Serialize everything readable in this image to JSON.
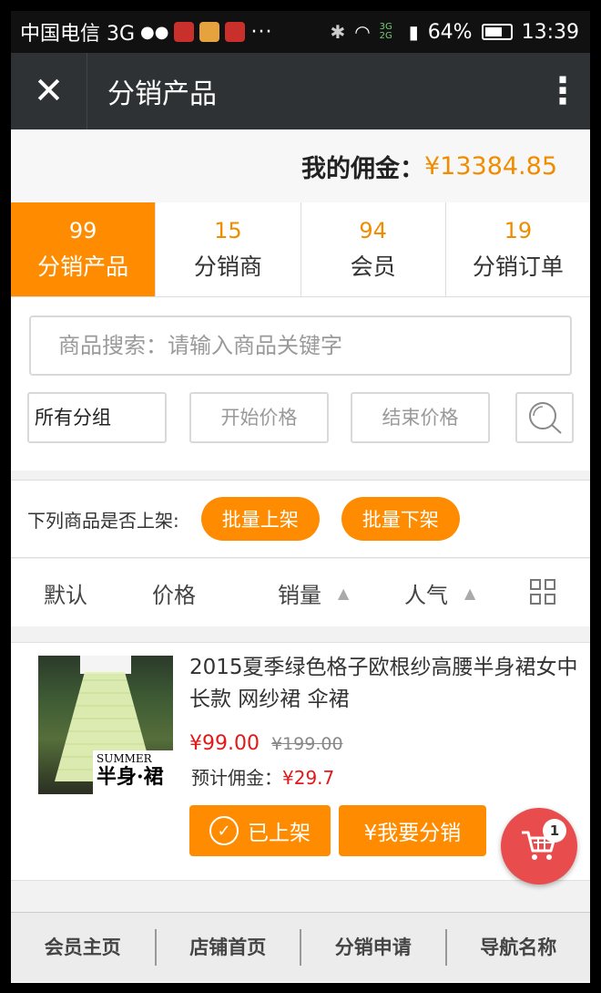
{
  "status_bar": {
    "carrier": "中国电信 3G",
    "dots": "···",
    "net": "3G 2G",
    "battery": "64%",
    "time": "13:39"
  },
  "nav": {
    "title": "分销产品",
    "close_icon": "close-icon",
    "more_icon": "more-vertical-icon"
  },
  "commission": {
    "label": "我的佣金：",
    "value": "¥13384.85"
  },
  "stats": [
    {
      "num": "99",
      "label": "分销产品",
      "active": true
    },
    {
      "num": "15",
      "label": "分销商",
      "active": false
    },
    {
      "num": "94",
      "label": "会员",
      "active": false
    },
    {
      "num": "19",
      "label": "分销订单",
      "active": false
    }
  ],
  "filters": {
    "search_placeholder": "商品搜索：请输入商品关键字",
    "group": "所有分组",
    "start_price": "开始价格",
    "end_price": "结束价格"
  },
  "batch": {
    "question": "下列商品是否上架:",
    "on_label": "批量上架",
    "off_label": "批量下架"
  },
  "sort": {
    "default": "默认",
    "price": "价格",
    "sales": "销量",
    "popularity": "人气"
  },
  "product": {
    "title": "2015夏季绿色格子欧根纱高腰半身裙女中长款 网纱裙 伞裙",
    "price": "¥99.00",
    "original_price": "¥199.00",
    "commission_label": "预计佣金：",
    "commission_value": "¥29.7",
    "listed_label": "已上架",
    "distribute_label": "¥我要分销",
    "image_text_1": "SUMMER",
    "image_text_2": "半身·裙"
  },
  "cart": {
    "count": "1"
  },
  "footer": [
    "会员主页",
    "店铺首页",
    "分销申请",
    "导航名称"
  ],
  "colors": {
    "accent": "#ff8c00",
    "price_red": "#e31818",
    "nav_bg": "#2e3234",
    "cart_red": "#e84c4c"
  }
}
